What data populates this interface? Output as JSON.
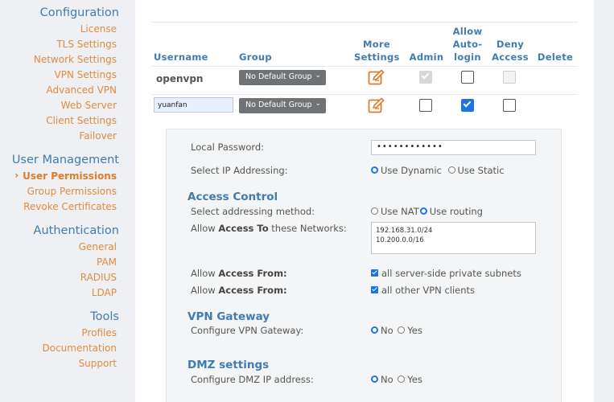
{
  "sidebar": {
    "configuration": {
      "heading": "Configuration",
      "items": [
        "License",
        "TLS Settings",
        "Network Settings",
        "VPN Settings",
        "Advanced VPN",
        "Web Server",
        "Client Settings",
        "Failover"
      ]
    },
    "user_management": {
      "heading": "User Management",
      "active_item": "User Permissions",
      "items": [
        "Group Permissions",
        "Revoke Certificates"
      ]
    },
    "authentication": {
      "heading": "Authentication",
      "items": [
        "General",
        "PAM",
        "RADIUS",
        "LDAP"
      ]
    },
    "tools": {
      "heading": "Tools",
      "items": [
        "Profiles",
        "Documentation",
        "Support"
      ]
    }
  },
  "table": {
    "headers": {
      "username": "Username",
      "group": "Group",
      "more_settings": [
        "More",
        "Settings"
      ],
      "admin": "Admin",
      "allow_autologin": [
        "Allow",
        "Auto-",
        "login"
      ],
      "deny_access": [
        "Deny",
        "Access"
      ],
      "delete": "Delete"
    },
    "rows": [
      {
        "username": "openvpn",
        "group": "No Default Group",
        "admin": true,
        "admin_disabled": true,
        "autologin": false,
        "deny": false,
        "deny_disabled": true
      },
      {
        "username": "yuanfan",
        "group": "No Default Group",
        "admin": false,
        "autologin": true,
        "deny": false
      }
    ]
  },
  "details": {
    "local_password": {
      "label": "Local Password:",
      "value": "••••••••••••"
    },
    "ip_addressing": {
      "label": "Select IP Addressing:",
      "option_dynamic": "Use Dynamic",
      "option_static": "Use Static",
      "selected": "dynamic"
    },
    "access_control": {
      "heading": "Access Control",
      "addressing_method_label": "Select addressing method:",
      "option_nat": "Use NAT",
      "option_routing": "Use routing",
      "selected": "routing",
      "networks_label_pre": "Allow ",
      "networks_label_bold": "Access To",
      "networks_label_post": " these Networks:",
      "networks_value": "192.168.31.0/24\n10.200.0.0/16",
      "access_from_pre": "Allow ",
      "access_from_bold": "Access From:",
      "private_subnets": "all server-side private subnets",
      "vpn_clients": "all other VPN clients"
    },
    "vpn_gateway": {
      "heading": "VPN Gateway",
      "label": "Configure VPN Gateway:",
      "no": "No",
      "yes": "Yes",
      "selected": "no"
    },
    "dmz": {
      "heading": "DMZ settings",
      "label": "Configure DMZ IP address:",
      "no": "No",
      "yes": "Yes",
      "selected": "no"
    }
  },
  "colors": {
    "heading_blue": "#3e7cb1",
    "link_orange": "#e08b3e",
    "check_blue": "#1a73e8"
  },
  "icons": {
    "more_settings": "edit-icon",
    "active_marker": "chevron-right-icon",
    "dropdown": "chevron-down-icon"
  }
}
